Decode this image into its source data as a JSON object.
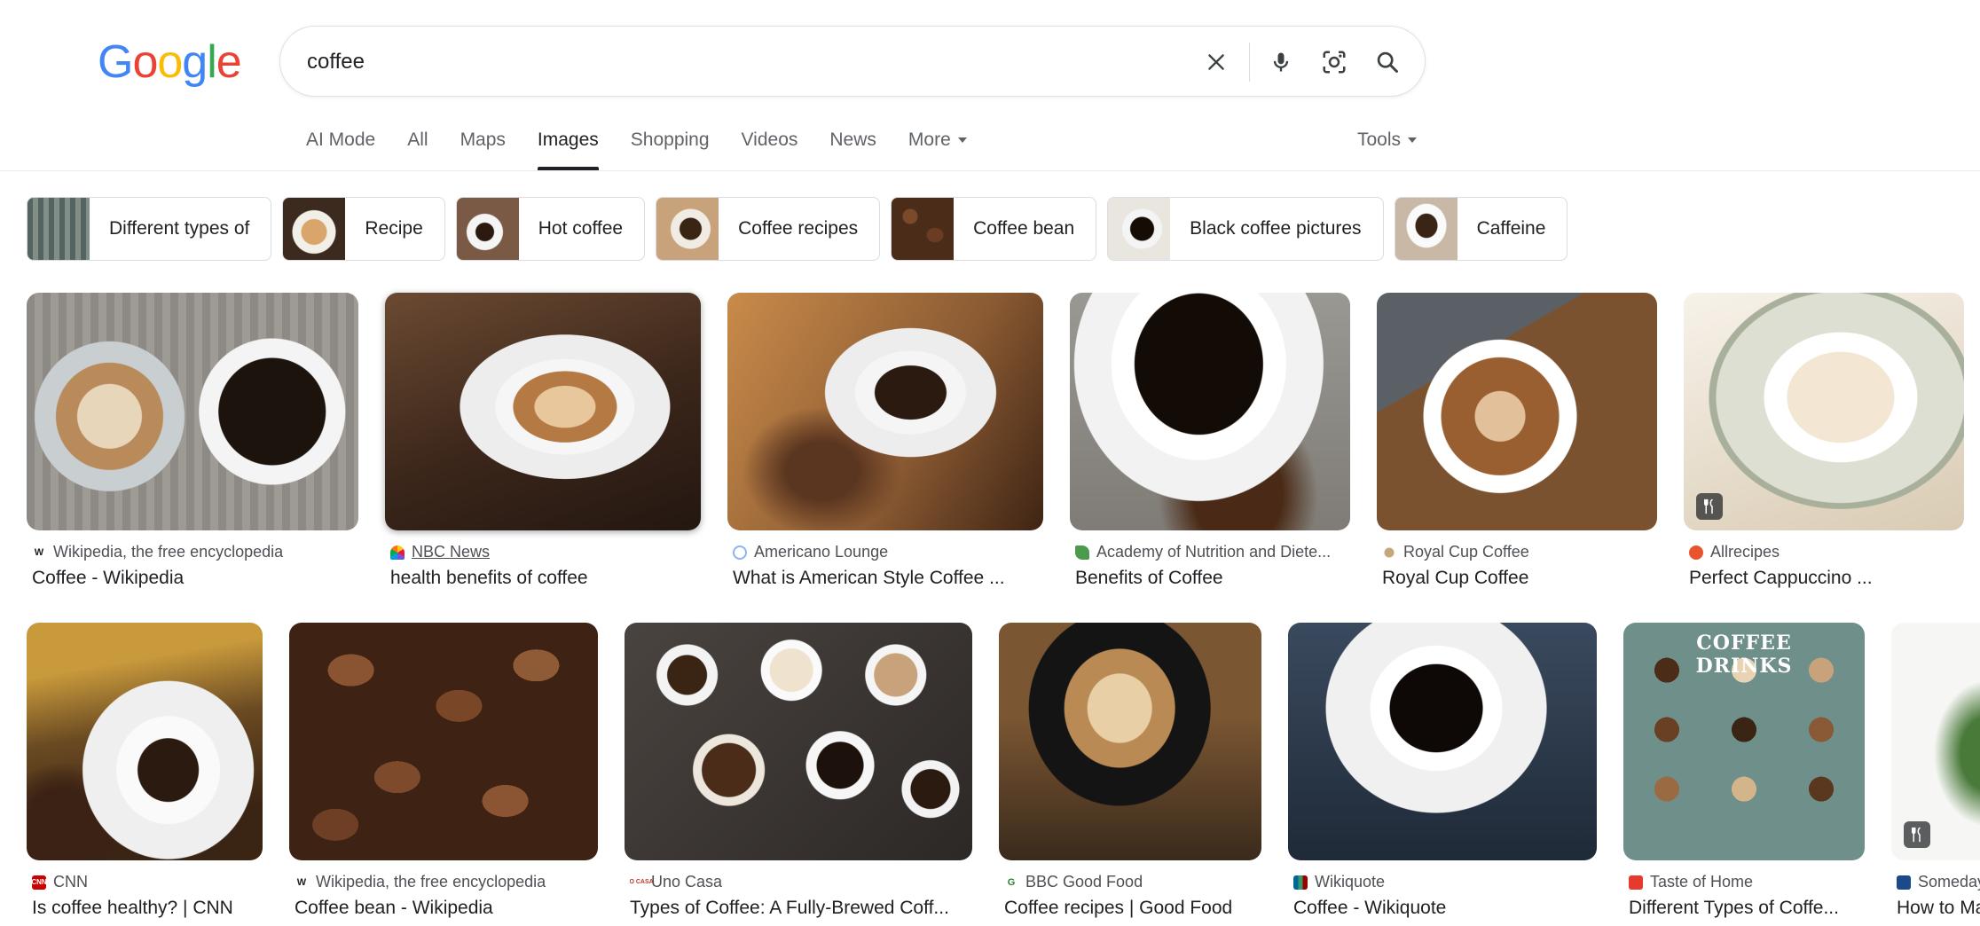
{
  "search": {
    "query": "coffee"
  },
  "tabs": [
    {
      "label": "AI Mode"
    },
    {
      "label": "All"
    },
    {
      "label": "Maps"
    },
    {
      "label": "Images"
    },
    {
      "label": "Shopping"
    },
    {
      "label": "Videos"
    },
    {
      "label": "News"
    },
    {
      "label": "More"
    }
  ],
  "tools_label": "Tools",
  "chips": [
    {
      "label": "Different types of"
    },
    {
      "label": "Recipe"
    },
    {
      "label": "Hot coffee"
    },
    {
      "label": "Coffee recipes"
    },
    {
      "label": "Coffee bean"
    },
    {
      "label": "Black coffee pictures"
    },
    {
      "label": "Caffeine"
    }
  ],
  "results": [
    {
      "source": "Wikipedia, the free encyclopedia",
      "title": "Coffee - Wikipedia"
    },
    {
      "source": "NBC News",
      "title": "health benefits of coffee"
    },
    {
      "source": "Americano Lounge",
      "title": "What is American Style Coffee ..."
    },
    {
      "source": "Academy of Nutrition and Diete...",
      "title": "Benefits of Coffee"
    },
    {
      "source": "Royal Cup Coffee",
      "title": "Royal Cup Coffee"
    },
    {
      "source": "Allrecipes",
      "title": "Perfect Cappuccino ..."
    },
    {
      "source": "CNN",
      "title": "Is coffee healthy? | CNN"
    },
    {
      "source": "Wikipedia, the free encyclopedia",
      "title": "Coffee bean - Wikipedia"
    },
    {
      "source": "Uno Casa",
      "title": "Types of Coffee: A Fully-Brewed Coff..."
    },
    {
      "source": "BBC Good Food",
      "title": "Coffee recipes | Good Food"
    },
    {
      "source": "Wikiquote",
      "title": "Coffee - Wikiquote"
    },
    {
      "source": "Taste of Home",
      "title": "Different Types of Coffe..."
    },
    {
      "source": "Someday",
      "title": "How to Ma"
    }
  ],
  "colors": {
    "google_blue": "#4285F4",
    "google_red": "#EA4335",
    "google_yellow": "#FBBC05",
    "google_green": "#34A853"
  }
}
